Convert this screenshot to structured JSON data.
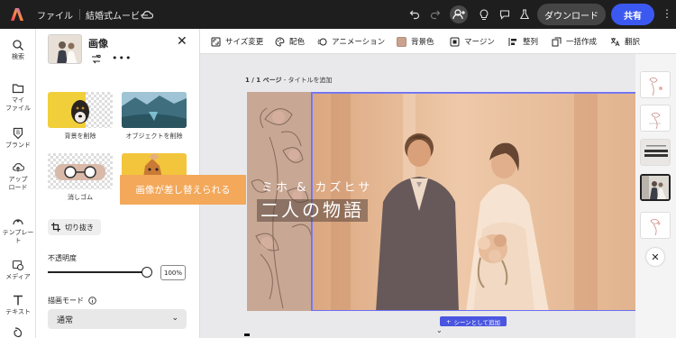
{
  "topbar": {
    "file_menu": "ファイル",
    "project_name": "結婚式ムービー",
    "download_label": "ダウンロード",
    "share_label": "共有"
  },
  "rail": {
    "items": [
      {
        "label": "検索",
        "icon": "search-icon"
      },
      {
        "label": "マイ\nファイル",
        "icon": "folder-icon"
      },
      {
        "label": "ブランド",
        "icon": "brand-icon"
      },
      {
        "label": "アップ\nロード",
        "icon": "upload-icon"
      },
      {
        "label": "テンプレート",
        "icon": "template-icon"
      },
      {
        "label": "メディア",
        "icon": "media-icon"
      },
      {
        "label": "テキスト",
        "icon": "text-icon"
      }
    ]
  },
  "panel": {
    "title": "画像",
    "tools": [
      {
        "label": "背景を削除"
      },
      {
        "label": "オブジェクトを削除"
      },
      {
        "label": "消しゴム"
      }
    ],
    "crop_label": "切り抜き",
    "opacity_label": "不透明度",
    "opacity_value": "100%",
    "opacity_fraction": 1.0,
    "blend_mode_label": "描画モード",
    "blend_mode_value": "通常"
  },
  "toolbar": {
    "items": [
      {
        "label": "サイズ変更",
        "icon": "resize-icon"
      },
      {
        "label": "配色",
        "icon": "palette-icon"
      },
      {
        "label": "アニメーション",
        "icon": "animation-icon"
      },
      {
        "label": "背景色",
        "icon": "background-color-swatch",
        "color": "#caa38e"
      },
      {
        "label": "マージン",
        "icon": "margin-icon"
      },
      {
        "label": "整列",
        "icon": "align-icon"
      },
      {
        "label": "一括作成",
        "icon": "bulk-create-icon"
      },
      {
        "label": "翻訳",
        "icon": "translate-icon"
      }
    ]
  },
  "canvas": {
    "page_number": "1 / 1 ページ",
    "page_title_placeholder": " - タイトルを追加",
    "title_line1": "ミホ & カズヒサ",
    "title_line2": "二人の物語",
    "tooltip": "画像が差し替えられる",
    "add_scene_label": "シーンとして追加"
  },
  "colors": {
    "accent": "#3b59f0",
    "tooltip": "#f3a85a",
    "slide_bg": "#c8a894",
    "selection": "#6e6ff0"
  }
}
